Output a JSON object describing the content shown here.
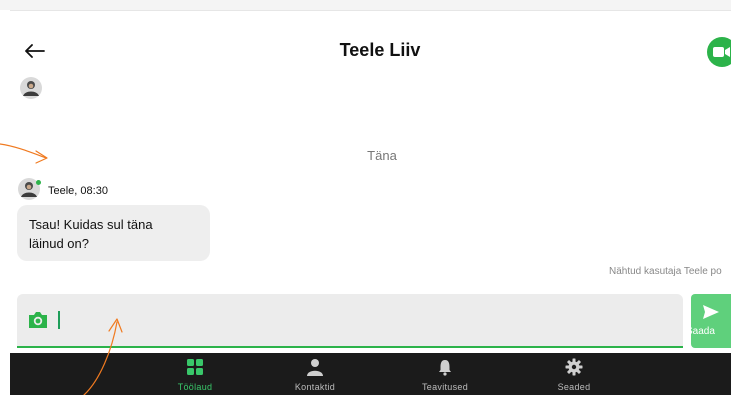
{
  "header": {
    "title": "Teele Liiv",
    "back_icon": "back-arrow-icon",
    "video_icon": "video-camera-icon"
  },
  "chat": {
    "day_divider": "Täna",
    "messages": [
      {
        "sender_meta": "Teele, 08:30",
        "text_line1": "Tsau! Kuidas sul täna",
        "text_line2": "läinud on?"
      }
    ],
    "seen_status": "Nähtud kasutaja Teele po"
  },
  "composer": {
    "camera_icon": "camera-icon",
    "send_icon": "send-icon",
    "send_label": "Saada"
  },
  "bottom_nav": {
    "items": [
      {
        "label": "Töölaud",
        "icon": "dashboard-icon",
        "active": true
      },
      {
        "label": "Kontaktid",
        "icon": "person-icon",
        "active": false
      },
      {
        "label": "Teavitused",
        "icon": "bell-icon",
        "active": false
      },
      {
        "label": "Seaded",
        "icon": "gear-icon",
        "active": false
      }
    ]
  },
  "colors": {
    "accent": "#2cb34a",
    "send_button": "#5fd07c",
    "annotation": "#f07a20",
    "nav_bg": "#1b1b1b"
  }
}
